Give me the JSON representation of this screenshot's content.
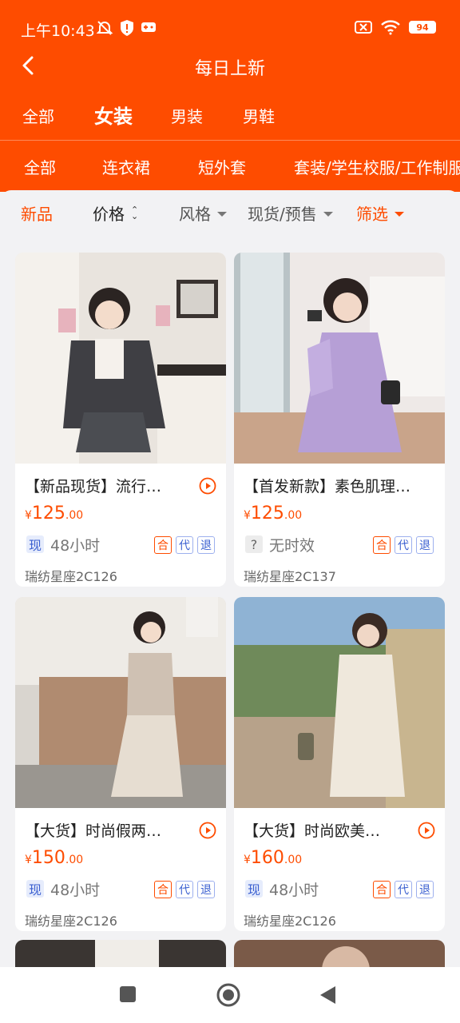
{
  "status": {
    "time": "上午10:43",
    "battery": "94",
    "left_icons": [
      "mute-bell-icon",
      "shield-icon",
      "gamepad-icon"
    ],
    "right_icons": [
      "no-sim-icon",
      "wifi-icon",
      "battery-icon"
    ]
  },
  "nav": {
    "title": "每日上新",
    "back_icon": "back-arrow-icon"
  },
  "tabs1": {
    "items": [
      "全部",
      "女装",
      "男装",
      "男鞋"
    ],
    "active": "女装"
  },
  "tabs2": {
    "items": [
      "全部",
      "连衣裙",
      "短外套",
      "套装/学生校服/工作制服"
    ]
  },
  "filters": {
    "new": "新品",
    "price": "价格",
    "style": "风格",
    "stock": "现货/预售",
    "screen": "筛选"
  },
  "colors": {
    "accent": "#fe4c00",
    "blue": "#3a5fd0"
  },
  "products": [
    {
      "title": "【新品现货】流行…",
      "currency": "¥",
      "price_int": "125",
      "price_dec": ".00",
      "stock_badge": "现",
      "stock_text": "48小时",
      "tags": [
        "合",
        "代",
        "退"
      ],
      "shop": "瑞纺星座2C126"
    },
    {
      "title": "【首发新款】素色肌理…",
      "currency": "¥",
      "price_int": "125",
      "price_dec": ".00",
      "stock_badge": "?",
      "stock_text": "无时效",
      "tags": [
        "合",
        "代",
        "退"
      ],
      "shop": "瑞纺星座2C137"
    },
    {
      "title": "【大货】时尚假两…",
      "currency": "¥",
      "price_int": "150",
      "price_dec": ".00",
      "stock_badge": "现",
      "stock_text": "48小时",
      "tags": [
        "合",
        "代",
        "退"
      ],
      "shop": "瑞纺星座2C126"
    },
    {
      "title": "【大货】时尚欧美…",
      "currency": "¥",
      "price_int": "160",
      "price_dec": ".00",
      "stock_badge": "现",
      "stock_text": "48小时",
      "tags": [
        "合",
        "代",
        "退"
      ],
      "shop": "瑞纺星座2C126"
    }
  ],
  "sysnav": [
    "recents-square-icon",
    "home-circle-icon",
    "back-triangle-icon"
  ]
}
